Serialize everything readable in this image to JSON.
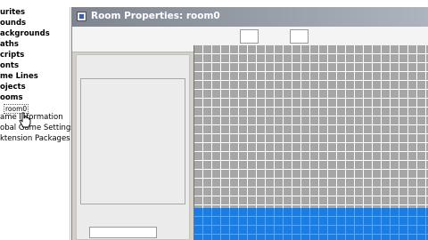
{
  "window": {
    "title": "Room Properties: room0"
  },
  "tree": {
    "items": [
      {
        "label": "urites",
        "bold": true
      },
      {
        "label": "ounds",
        "bold": true
      },
      {
        "label": "ackgrounds",
        "bold": true
      },
      {
        "label": "aths",
        "bold": true
      },
      {
        "label": "cripts",
        "bold": true
      },
      {
        "label": "onts",
        "bold": true
      },
      {
        "label": "me Lines",
        "bold": true
      },
      {
        "label": "ojects",
        "bold": true
      },
      {
        "label": "ooms",
        "bold": true
      },
      {
        "label": "room0",
        "bold": false,
        "selected": true
      },
      {
        "label": "ame Information",
        "bold": false
      },
      {
        "label": "obal Game Settings",
        "bold": false
      },
      {
        "label": "ktension Packages",
        "bold": false
      }
    ]
  },
  "room": {
    "grid_color": "#a6a6a6",
    "grid_line_color": "#ffffff",
    "tile_color": "#1a7de6",
    "tile_line_color": "#5aa7f2"
  }
}
